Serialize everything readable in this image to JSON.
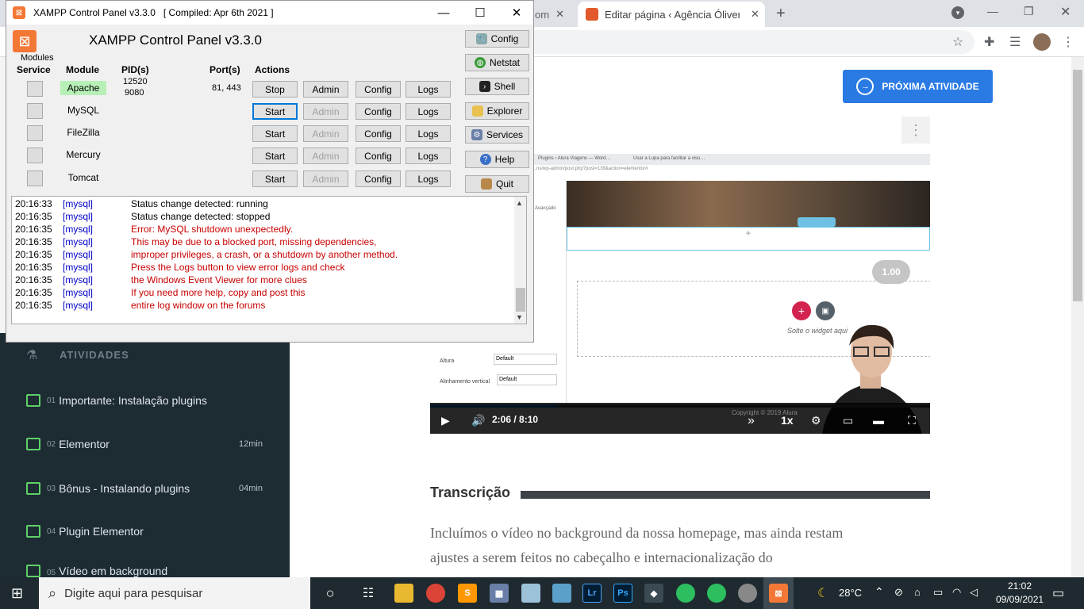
{
  "browser": {
    "tabs": [
      {
        "label": "om",
        "active": false
      },
      {
        "label": "Editar página ‹ Agência Óliver —",
        "active": true
      }
    ],
    "new_tab": "+"
  },
  "sidebar": {
    "section_title": "ATIVIDADES",
    "items": [
      {
        "num": "01",
        "label": "Importante: Instalação plugins",
        "duration": "",
        "icon": "book-icon"
      },
      {
        "num": "02",
        "label": "Elementor",
        "duration": "12min",
        "icon": "play-icon"
      },
      {
        "num": "03",
        "label": "Bônus - Instalando plugins",
        "duration": "04min",
        "icon": "play-icon"
      },
      {
        "num": "04",
        "label": "Plugin Elementor",
        "duration": "",
        "icon": "list-icon"
      },
      {
        "num": "05",
        "label": "Vídeo em background",
        "duration": "",
        "icon": "list-icon"
      }
    ]
  },
  "main": {
    "next_button": "PRÓXIMA ATIVIDADE",
    "transcript_title": "Transcrição",
    "transcript_text": "Incluímos o vídeo no background da nossa homepage, mas ainda restam ajustes a serem feitos no cabeçalho e internacionalização do"
  },
  "video": {
    "tab1": "Plugins ‹ Alura Viagens — Word…",
    "tab2": "Usar a Lupa para facilitar a visu…",
    "url": "…ns/wp-admin/post.php?post=139&action=elementor#",
    "drop_label": "Solte o widget aqui",
    "speed_badge": "1.00",
    "time": "2:06 / 8:10",
    "rate": "1x",
    "copyright": "Copyright © 2019 Alura",
    "side_fields": [
      {
        "label": "Altura",
        "value": "Default"
      },
      {
        "label": "Alinhamento vertical",
        "value": "Default"
      }
    ],
    "advanced": "Avançado",
    "progress_fraction": 0.257
  },
  "xampp": {
    "window_title": "XAMPP Control Panel v3.3.0   [ Compiled: Apr 6th 2021 ]",
    "heading": "XAMPP Control Panel v3.3.0",
    "modules_label": "Modules",
    "headers": {
      "service": "Service",
      "module": "Module",
      "pids": "PID(s)",
      "ports": "Port(s)",
      "actions": "Actions"
    },
    "rows": [
      {
        "module": "Apache",
        "pids": [
          "12520",
          "9080"
        ],
        "ports": "81, 443",
        "start": "Stop",
        "admin": "Admin",
        "config": "Config",
        "logs": "Logs",
        "running": true
      },
      {
        "module": "MySQL",
        "pids": [],
        "ports": "",
        "start": "Start",
        "admin": "Admin",
        "config": "Config",
        "logs": "Logs",
        "running": false
      },
      {
        "module": "FileZilla",
        "pids": [],
        "ports": "",
        "start": "Start",
        "admin": "Admin",
        "config": "Config",
        "logs": "Logs",
        "running": false
      },
      {
        "module": "Mercury",
        "pids": [],
        "ports": "",
        "start": "Start",
        "admin": "Admin",
        "config": "Config",
        "logs": "Logs",
        "running": false
      },
      {
        "module": "Tomcat",
        "pids": [],
        "ports": "",
        "start": "Start",
        "admin": "Admin",
        "config": "Config",
        "logs": "Logs",
        "running": false
      }
    ],
    "right_buttons": [
      "Config",
      "Netstat",
      "Shell",
      "Explorer",
      "Services",
      "Help",
      "Quit"
    ],
    "log": [
      {
        "time": "20:16:33",
        "src": "[mysql]",
        "msg": "Status change detected: running",
        "error": false
      },
      {
        "time": "20:16:35",
        "src": "[mysql]",
        "msg": "Status change detected: stopped",
        "error": false
      },
      {
        "time": "20:16:35",
        "src": "[mysql]",
        "msg": "Error: MySQL shutdown unexpectedly.",
        "error": true
      },
      {
        "time": "20:16:35",
        "src": "[mysql]",
        "msg": "This may be due to a blocked port, missing dependencies,",
        "error": true
      },
      {
        "time": "20:16:35",
        "src": "[mysql]",
        "msg": "improper privileges, a crash, or a shutdown by another method.",
        "error": true
      },
      {
        "time": "20:16:35",
        "src": "[mysql]",
        "msg": "Press the Logs button to view error logs and check",
        "error": true
      },
      {
        "time": "20:16:35",
        "src": "[mysql]",
        "msg": "the Windows Event Viewer for more clues",
        "error": true
      },
      {
        "time": "20:16:35",
        "src": "[mysql]",
        "msg": "If you need more help, copy and post this",
        "error": true
      },
      {
        "time": "20:16:35",
        "src": "[mysql]",
        "msg": "entire log window on the forums",
        "error": true
      }
    ]
  },
  "taskbar": {
    "search_placeholder": "Digite aqui para pesquisar",
    "temperature": "28°C",
    "time": "21:02",
    "date": "09/09/2021"
  },
  "colors": {
    "accent": "#2a7ae4",
    "sidebar_bg": "#1d2b33",
    "xampp_orange": "#f37836",
    "log_error": "#c80000",
    "log_source": "#0000c8",
    "apache_running": "#b7f0b7"
  }
}
